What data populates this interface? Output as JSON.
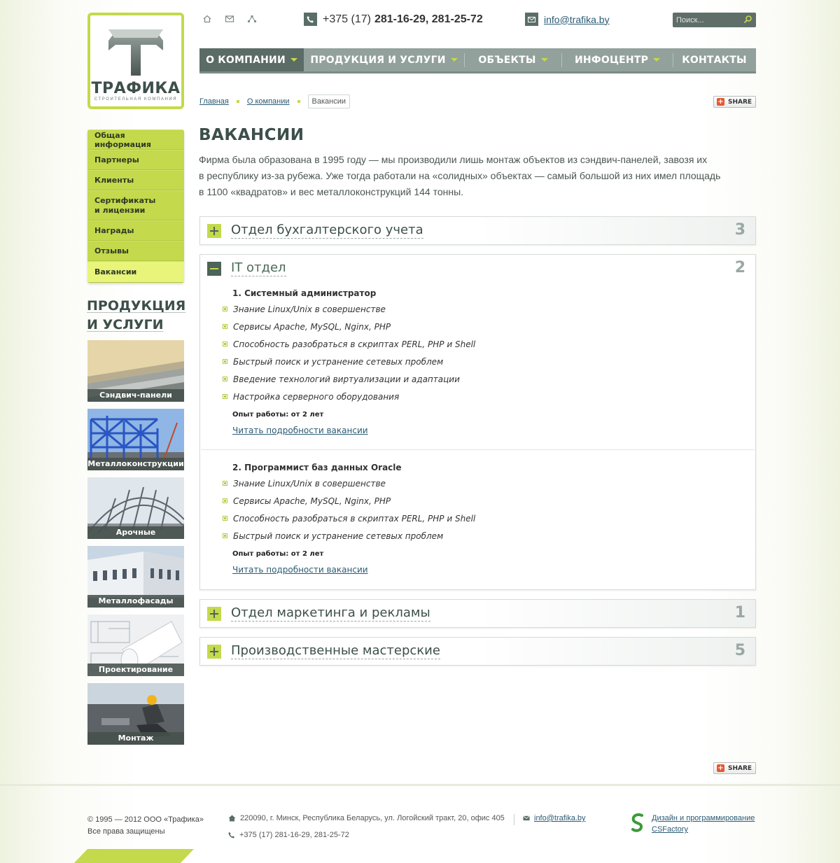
{
  "logo": {
    "name": "ТРАФИКА",
    "subtitle": "СТРОИТЕЛЬНАЯ КОМПАНИЯ"
  },
  "top": {
    "icons": [
      "home-icon",
      "mail-icon",
      "sitemap-icon"
    ],
    "phone_prefix": "+375 (17)",
    "phone_numbers": "281-16-29, 281-25-72",
    "email": "info@trafika.by",
    "search_placeholder": "Поиск..."
  },
  "nav": [
    {
      "label": "О КОМПАНИИ",
      "active": true,
      "dropdown": true
    },
    {
      "label": "ПРОДУКЦИЯ И УСЛУГИ",
      "active": false,
      "dropdown": true
    },
    {
      "label": "ОБЪЕКТЫ",
      "active": false,
      "dropdown": true
    },
    {
      "label": "ИНФОЦЕНТР",
      "active": false,
      "dropdown": true
    },
    {
      "label": "КОНТАКТЫ",
      "active": false,
      "dropdown": false
    }
  ],
  "breadcrumb": {
    "home": "Главная",
    "section": "О компании",
    "current": "Вакансии"
  },
  "share_label": "SHARE",
  "sidebar": {
    "items": [
      {
        "label": "Общая информация"
      },
      {
        "label": "Партнеры"
      },
      {
        "label": "Клиенты"
      },
      {
        "label": "Сертификаты\nи лицензии"
      },
      {
        "label": "Награды"
      },
      {
        "label": "Отзывы"
      },
      {
        "label": "Вакансии",
        "active": true
      }
    ],
    "products_title_1": "ПРОДУКЦИЯ",
    "products_title_2": "И УСЛУГИ",
    "products": [
      {
        "label": "Сэндвич-панели"
      },
      {
        "label": "Металлоконструкции"
      },
      {
        "label": "Арочные конструкции"
      },
      {
        "label": "Металлофасады"
      },
      {
        "label": "Проектирование"
      },
      {
        "label": "Монтаж"
      }
    ]
  },
  "main": {
    "title": "ВАКАНСИИ",
    "intro_1": "Фирма была образована в 1995 году — мы производили лишь монтаж объектов из сэндвич-панелей, завозя их",
    "intro_2": "в республику из-за рубежа. Уже тогда работали на «солидных» объектах — самый большой из них имел площадь",
    "intro_3": "в 1100 «квадратов» и вес металлоконструкций 144 тонны.",
    "departments": [
      {
        "title": "Отдел бухгалтерского учета",
        "count": "3",
        "open": false
      },
      {
        "title": "IT отдел",
        "count": "2",
        "open": true
      },
      {
        "title": "Отдел маркетинга и рекламы",
        "count": "1",
        "open": false
      },
      {
        "title": "Производственные мастерские",
        "count": "5",
        "open": false
      }
    ],
    "jobs": [
      {
        "title": "1. Системный администратор",
        "requirements": [
          "Знание Linux/Unix в совершенстве",
          "Сервисы Apache, MySQL, Nginx, PHP",
          "Способность разобраться в скриптах PERL, PHP и Shell",
          "Быстрый поиск и устранение сетевых проблем",
          "Введение технологий виртуализации и адаптации",
          "Настройка серверного оборудования"
        ],
        "experience": "Опыт работы: от 2 лет",
        "more": "Читать подробности вакансии"
      },
      {
        "title": "2. Программист баз данных Oracle",
        "requirements": [
          "Знание Linux/Unix в совершенстве",
          "Сервисы Apache, MySQL, Nginx, PHP",
          "Способность разобраться в скриптах PERL, PHP и Shell",
          "Быстрый поиск и устранение сетевых проблем"
        ],
        "experience": "Опыт работы: от 2 лет",
        "more": "Читать подробности вакансии"
      }
    ]
  },
  "footer": {
    "copyright": "© 1995 — 2012 ООО «Трафика»",
    "rights": "Все права защищены",
    "address": "220090, г. Минск, Республика Беларусь, ул. Логойский тракт, 20, офис 405",
    "phone": "+375 (17) 281-16-29, 281-25-72",
    "email": "info@trafika.by",
    "dev_1": "Дизайн и программирование",
    "dev_2": "CSFactory"
  },
  "colors": {
    "accent": "#c4d94b",
    "nav": "#92a19b",
    "nav_active": "#5b6b66",
    "text_dark": "#3d4f4a"
  }
}
